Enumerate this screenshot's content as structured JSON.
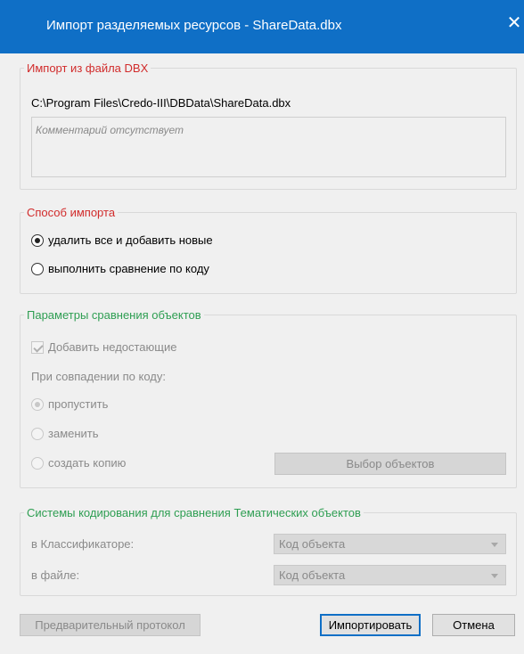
{
  "window": {
    "title": "Импорт разделяемых ресурсов - ShareData.dbx",
    "close_glyph": "✕"
  },
  "import_file": {
    "legend": "Импорт из файла DBX",
    "path": "C:\\Program Files\\Credo-III\\DBData\\ShareData.dbx",
    "comment": "Комментарий отсутствует"
  },
  "import_method": {
    "legend": "Способ импорта",
    "options": [
      {
        "label": "удалить все и добавить новые",
        "selected": true
      },
      {
        "label": "выполнить сравнение по коду",
        "selected": false
      }
    ]
  },
  "compare_params": {
    "legend": "Параметры сравнения объектов",
    "add_missing_label": "Добавить недостающие",
    "add_missing_checked": true,
    "on_match_label": "При совпадении по коду:",
    "options": [
      {
        "label": "пропустить",
        "selected": true
      },
      {
        "label": "заменить",
        "selected": false
      },
      {
        "label": "создать копию",
        "selected": false
      }
    ],
    "select_objects_button": "Выбор объектов"
  },
  "coding_systems": {
    "legend": "Системы кодирования для сравнения Тематических объектов",
    "classifier_label": "в Классификаторе:",
    "classifier_value": "Код объекта",
    "file_label": "в файле:",
    "file_value": "Код объекта"
  },
  "footer": {
    "preview_log_button": "Предварительный протокол",
    "import_button": "Импортировать",
    "cancel_button": "Отмена"
  },
  "colors": {
    "titlebar": "#0f6fc6",
    "legend_red": "#d12b2b",
    "legend_green": "#2e9e52"
  }
}
